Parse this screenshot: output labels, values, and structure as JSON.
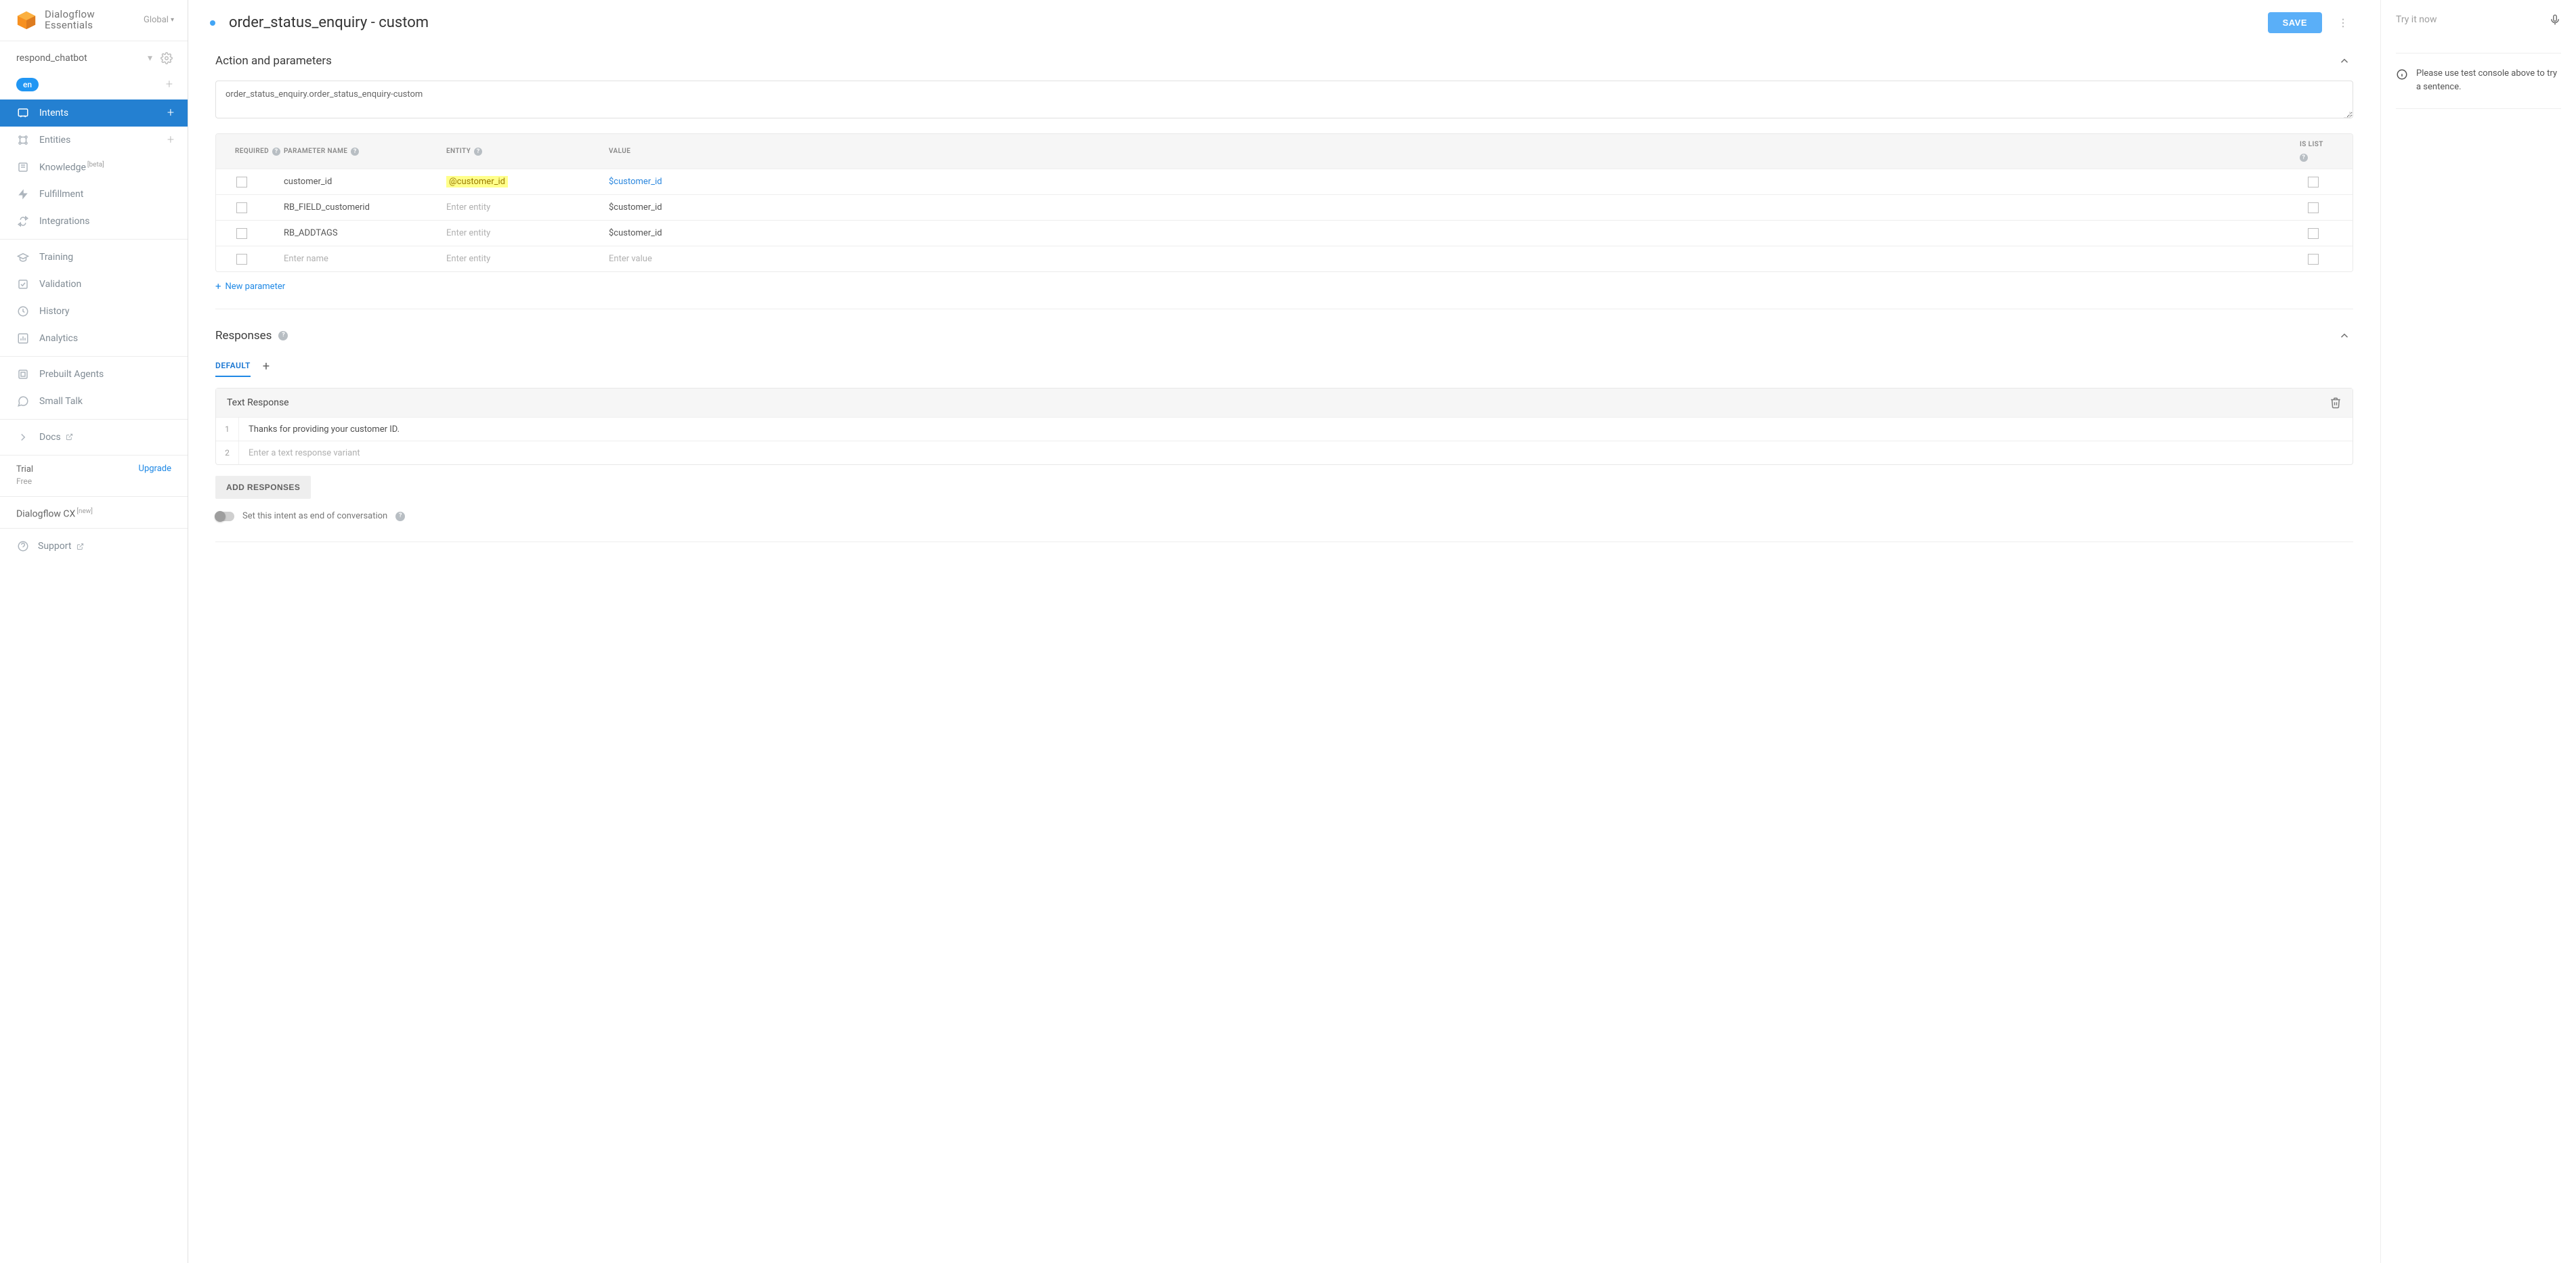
{
  "app": {
    "product_line1": "Dialogflow",
    "product_line2": "Essentials",
    "region_label": "Global"
  },
  "agent": {
    "name": "respond_chatbot",
    "language": "en"
  },
  "sidebar": {
    "items": [
      {
        "label": "Intents"
      },
      {
        "label": "Entities"
      },
      {
        "label": "Knowledge",
        "badge": "[beta]"
      },
      {
        "label": "Fulfillment"
      },
      {
        "label": "Integrations"
      },
      {
        "label": "Training"
      },
      {
        "label": "Validation"
      },
      {
        "label": "History"
      },
      {
        "label": "Analytics"
      },
      {
        "label": "Prebuilt Agents"
      },
      {
        "label": "Small Talk"
      },
      {
        "label": "Docs"
      }
    ],
    "trial": {
      "title": "Trial",
      "plan": "Free",
      "upgrade": "Upgrade"
    },
    "cx": {
      "label": "Dialogflow CX",
      "badge": "[new]"
    },
    "support": {
      "label": "Support"
    }
  },
  "header": {
    "title": "order_status_enquiry - custom",
    "save": "SAVE"
  },
  "action_section": {
    "title": "Action and parameters",
    "action_value": "order_status_enquiry.order_status_enquiry-custom",
    "columns": {
      "required": "REQUIRED",
      "name": "PARAMETER NAME",
      "entity": "ENTITY",
      "value": "VALUE",
      "islist": "IS LIST"
    },
    "rows": [
      {
        "name": "customer_id",
        "entity": "@customer_id",
        "entity_highlight": true,
        "value": "$customer_id",
        "value_accent": true
      },
      {
        "name": "RB_FIELD_customerid",
        "entity_placeholder": "Enter entity",
        "value": "$customer_id"
      },
      {
        "name": "RB_ADDTAGS",
        "entity_placeholder": "Enter entity",
        "value": "$customer_id"
      }
    ],
    "placeholder_row": {
      "name": "Enter name",
      "entity": "Enter entity",
      "value": "Enter value"
    },
    "new_param": "New parameter"
  },
  "responses_section": {
    "title": "Responses",
    "tab_default": "DEFAULT",
    "text_response_title": "Text Response",
    "rows": [
      {
        "idx": "1",
        "text": "Thanks for providing your customer ID."
      },
      {
        "idx": "2",
        "placeholder": "Enter a text response variant"
      }
    ],
    "add_responses": "ADD RESPONSES",
    "end_conv_label": "Set this intent as end of conversation"
  },
  "right": {
    "try_placeholder": "Try it now",
    "hint": "Please use test console above to try a sentence."
  }
}
